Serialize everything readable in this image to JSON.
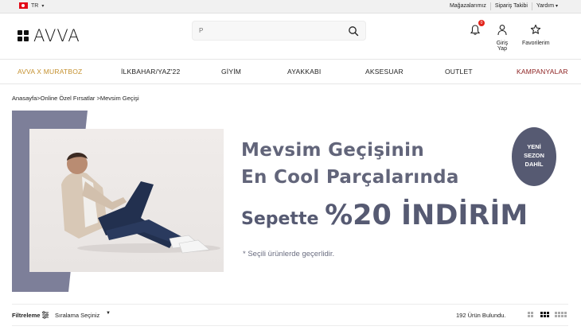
{
  "topbar": {
    "language": "TR",
    "links": [
      "Mağazalarımız",
      "Sipariş Takibi",
      "Yardım"
    ]
  },
  "header": {
    "logo_text": "AVVA",
    "search_placeholder": "P",
    "cart_count": "0",
    "account_label": "Giriş Yap",
    "favorites_label": "Favorilerim"
  },
  "nav": {
    "items": [
      "AVVA X MURATBOZ",
      "İLKBAHAR/YAZ'22",
      "GİYİM",
      "AYAKKABI",
      "AKSESUAR",
      "OUTLET",
      "KAMPANYALAR"
    ]
  },
  "breadcrumb": "Anasayfa>Online Özel Fırsatlar >Mevsim Geçişi",
  "banner": {
    "headline_line1": "Mevsim Geçişinin",
    "headline_line2": "En Cool Parçalarında",
    "discount_prefix": "Sepette ",
    "discount_value": "%20 İNDİRİM",
    "note": "* Seçili ürünlerde geçerlidir.",
    "badge_line1": "YENİ",
    "badge_line2": "SEZON",
    "badge_line3": "DAHİL",
    "colors": {
      "accent": "#565a72",
      "side_panel": "#7d7f99"
    }
  },
  "filterbar": {
    "filter_label": "Filtreleme",
    "sort_label": "Sıralama Seçiniz",
    "result_count": "192 Ürün Bulundu."
  }
}
